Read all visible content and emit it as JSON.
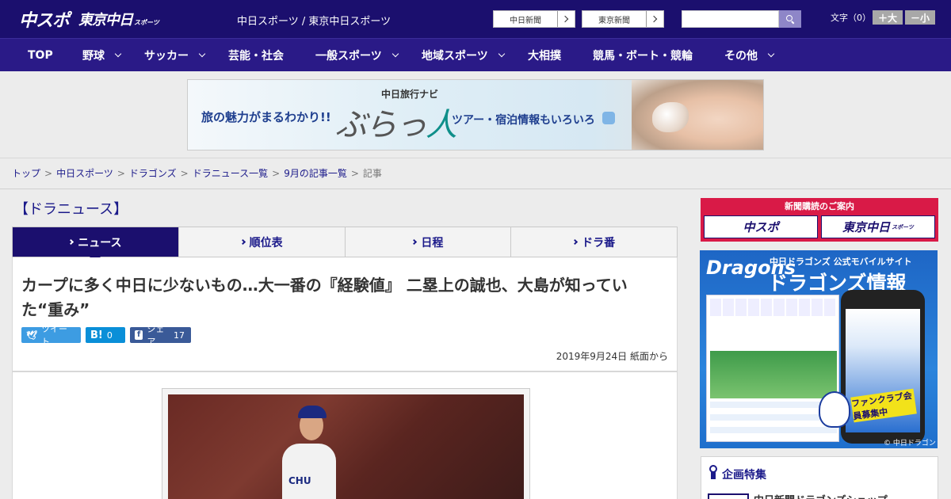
{
  "header": {
    "logo_primary": "中スポ",
    "logo_secondary": "東京中日",
    "logo_secondary_small": "スポーツ",
    "site_title": "中日スポーツ / 東京中日スポーツ",
    "paper_links": [
      "中日新聞",
      "東京新聞"
    ],
    "search": {
      "value": "",
      "placeholder": ""
    },
    "font_size_label": "文字（0）",
    "font_larger": "＋大",
    "font_smaller": "－小"
  },
  "nav": {
    "items": [
      {
        "label": "TOP",
        "has_menu": false
      },
      {
        "label": "野球",
        "has_menu": true
      },
      {
        "label": "サッカー",
        "has_menu": true
      },
      {
        "label": "芸能・社会",
        "has_menu": false
      },
      {
        "label": "一般スポーツ",
        "has_menu": true
      },
      {
        "label": "地域スポーツ",
        "has_menu": true
      },
      {
        "label": "大相撲",
        "has_menu": false
      },
      {
        "label": "競馬・ボート・競輪",
        "has_menu": false
      },
      {
        "label": "その他",
        "has_menu": true
      }
    ]
  },
  "banner": {
    "left_text": "旅の魅力がまるわかり!!",
    "brand_caption": "中日旅行ナビ",
    "brand_logo_a": "ぶらっ",
    "brand_logo_b": "人",
    "right_text": "ツアー・宿泊情報もいろいろ"
  },
  "breadcrumb": {
    "items": [
      "トップ",
      "中日スポーツ",
      "ドラゴンズ",
      "ドラニュース一覧",
      "9月の記事一覧",
      "記事"
    ],
    "separator": ">"
  },
  "main": {
    "section_title": "【ドラニュース】",
    "tabs": [
      {
        "label": "ニュース",
        "active": true
      },
      {
        "label": "順位表",
        "active": false
      },
      {
        "label": "日程",
        "active": false
      },
      {
        "label": "ドラ番",
        "active": false
      }
    ],
    "article": {
      "headline": "カープに多く中日に少ないもの…大一番の『経験値』 二塁上の誠也、大島が知っていた“重み”",
      "share": {
        "tweet_label": "ツイート",
        "hatena_symbol": "B!",
        "hatena_count": "0",
        "facebook_label": "シェア",
        "facebook_count": "17"
      },
      "date": "2019年9月24日 紙面から",
      "photo_jersey_text": "CHU"
    }
  },
  "sidebar": {
    "subscription": {
      "title": "新聞購読のご案内",
      "paper_a": "中スポ",
      "paper_b": "東京中日",
      "paper_b_small": "スポーツ"
    },
    "dragons_ad": {
      "script_logo": "Dragons",
      "subtitle": "中日ドラゴンズ 公式モバイルサイト",
      "title": "ドラゴンズ情報",
      "badge": "ファンクラブ会員募集中",
      "credit": "© 中日ドラゴンズ"
    },
    "feature": {
      "title": "企画特集",
      "first_item": "中日新聞ドラゴンズショップ"
    }
  },
  "colors": {
    "header_bg": "#1b0f6e",
    "nav_bg": "#2a1a87",
    "link": "#1b1a8a",
    "subscription_red": "#d91a47",
    "twitter": "#3d9ce2",
    "hatena": "#0a8fd8",
    "facebook": "#3a5a98"
  }
}
